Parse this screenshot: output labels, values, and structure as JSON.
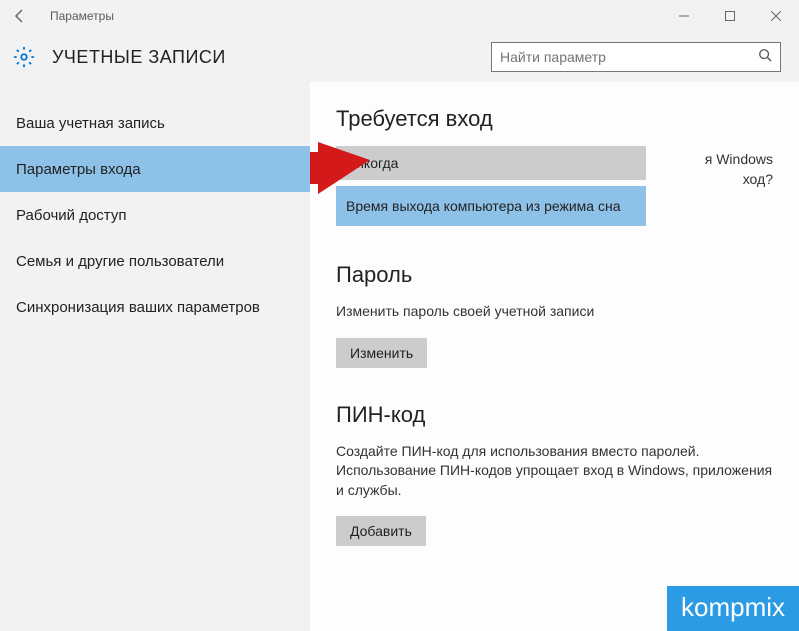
{
  "window": {
    "title": "Параметры"
  },
  "header": {
    "title": "УЧЕТНЫЕ ЗАПИСИ",
    "search_placeholder": "Найти параметр"
  },
  "sidebar": {
    "items": [
      {
        "label": "Ваша учетная запись"
      },
      {
        "label": "Параметры входа"
      },
      {
        "label": "Рабочий доступ"
      },
      {
        "label": "Семья и другие пользователи"
      },
      {
        "label": "Синхронизация ваших параметров"
      }
    ],
    "selected_index": 1
  },
  "main": {
    "signin": {
      "heading": "Требуется вход",
      "behind_text_line1": "я Windows",
      "behind_text_line2": "ход?",
      "selected": "Никогда",
      "option2": "Время выхода компьютера из режима сна"
    },
    "password": {
      "heading": "Пароль",
      "description": "Изменить пароль своей учетной записи",
      "button": "Изменить"
    },
    "pin": {
      "heading": "ПИН-код",
      "description": "Создайте ПИН-код для использования вместо паролей. Использование ПИН-кодов упрощает вход в Windows, приложения и службы.",
      "button": "Добавить"
    }
  },
  "watermark": "kompmix"
}
